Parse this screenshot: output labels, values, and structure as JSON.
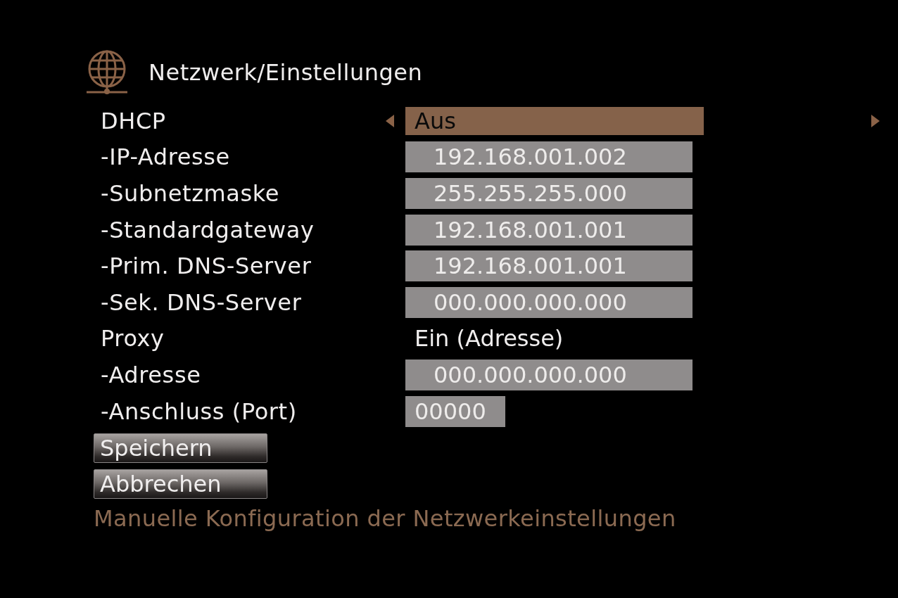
{
  "title": "Netzwerk/Einstellungen",
  "rows": [
    {
      "label": "DHCP",
      "kind": "selector",
      "value": "Aus",
      "selected": true
    },
    {
      "label": "-IP-Adresse",
      "kind": "field",
      "value": "192.168.001.002",
      "selected": false
    },
    {
      "label": "-Subnetzmaske",
      "kind": "field",
      "value": "255.255.255.000",
      "selected": false
    },
    {
      "label": "-Standardgateway",
      "kind": "field",
      "value": "192.168.001.001",
      "selected": false
    },
    {
      "label": "-Prim. DNS-Server",
      "kind": "field",
      "value": "192.168.001.001",
      "selected": false
    },
    {
      "label": "-Sek. DNS-Server",
      "kind": "field",
      "value": "000.000.000.000",
      "selected": false
    },
    {
      "label": "Proxy",
      "kind": "selector",
      "value": "Ein (Adresse)",
      "selected": false
    },
    {
      "label": "-Adresse",
      "kind": "field",
      "value": "000.000.000.000",
      "selected": false
    },
    {
      "label": "-Anschluss (Port)",
      "kind": "port",
      "value": "00000",
      "selected": false
    }
  ],
  "buttons": [
    {
      "label": "Speichern",
      "selected": false
    },
    {
      "label": "Abbrechen",
      "selected": false
    }
  ],
  "hint": "Manuelle Konfiguration der Netzwerkeinstellungen"
}
